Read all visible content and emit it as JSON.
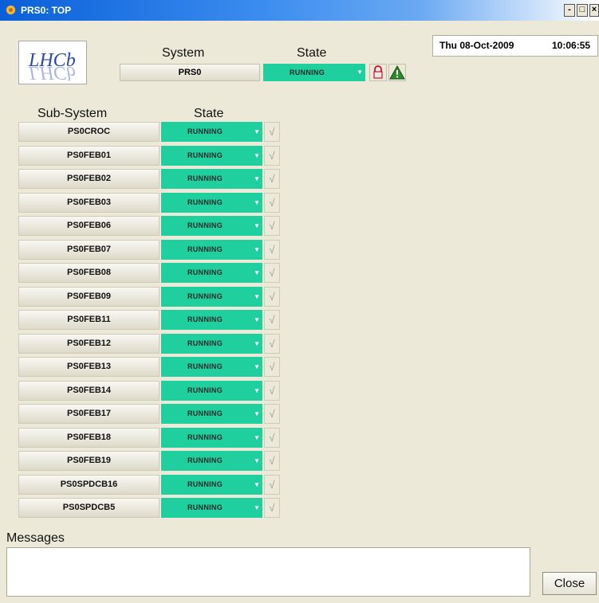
{
  "window": {
    "title": "PRS0: TOP",
    "min_label": "-",
    "max_label": "□",
    "close_label": "×"
  },
  "clock": {
    "date": "Thu 08-Oct-2009",
    "time": "10:06:55"
  },
  "logo": {
    "text": "LHCb"
  },
  "system": {
    "header_system": "System",
    "header_state": "State",
    "name": "PRS0",
    "state": "RUNNING"
  },
  "subsystems": {
    "header_subsystem": "Sub-System",
    "header_state": "State",
    "rows": [
      {
        "name": "PS0CROC",
        "state": "RUNNING"
      },
      {
        "name": "PS0FEB01",
        "state": "RUNNING"
      },
      {
        "name": "PS0FEB02",
        "state": "RUNNING"
      },
      {
        "name": "PS0FEB03",
        "state": "RUNNING"
      },
      {
        "name": "PS0FEB06",
        "state": "RUNNING"
      },
      {
        "name": "PS0FEB07",
        "state": "RUNNING"
      },
      {
        "name": "PS0FEB08",
        "state": "RUNNING"
      },
      {
        "name": "PS0FEB09",
        "state": "RUNNING"
      },
      {
        "name": "PS0FEB11",
        "state": "RUNNING"
      },
      {
        "name": "PS0FEB12",
        "state": "RUNNING"
      },
      {
        "name": "PS0FEB13",
        "state": "RUNNING"
      },
      {
        "name": "PS0FEB14",
        "state": "RUNNING"
      },
      {
        "name": "PS0FEB17",
        "state": "RUNNING"
      },
      {
        "name": "PS0FEB18",
        "state": "RUNNING"
      },
      {
        "name": "PS0FEB19",
        "state": "RUNNING"
      },
      {
        "name": "PS0SPDCB16",
        "state": "RUNNING"
      },
      {
        "name": "PS0SPDCB5",
        "state": "RUNNING"
      }
    ]
  },
  "messages": {
    "label": "Messages",
    "content": ""
  },
  "buttons": {
    "close": "Close"
  },
  "colors": {
    "running": "#1fcf9d",
    "titlebar": "#0a5fd8",
    "background": "#ece9d8"
  },
  "icons": {
    "app": "gear-icon",
    "lock": "lock-icon",
    "warning": "warning-icon",
    "check": "check-icon",
    "dropdown": "chevron-down-icon"
  }
}
